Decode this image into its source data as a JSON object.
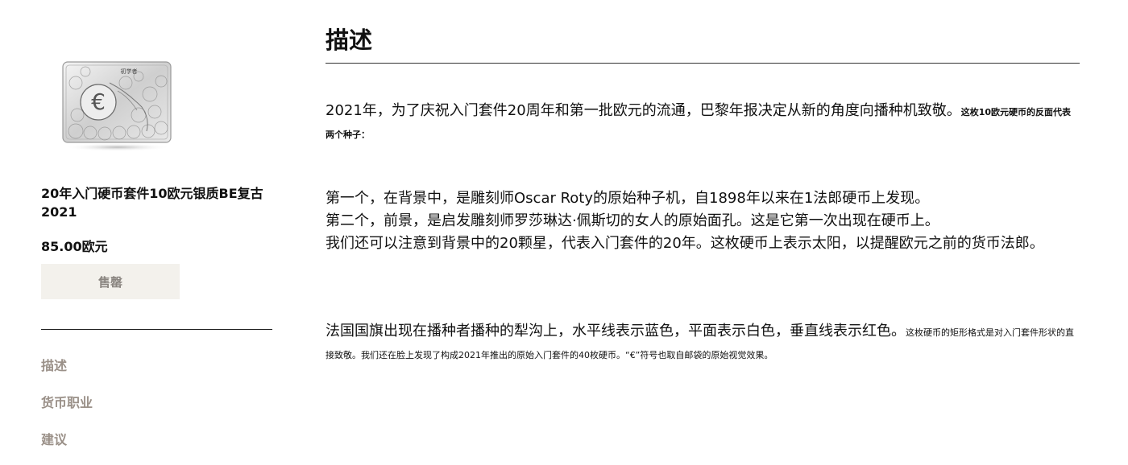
{
  "product": {
    "image_alt": "20年入门硬币套件10欧元银质BE复古2021",
    "coin_label": "初学者",
    "title": "20年入门硬币套件10欧元银质BE复古2021",
    "price": "85.00欧元",
    "button_label": "售罄"
  },
  "sidebar": {
    "nav": [
      {
        "label": "描述"
      },
      {
        "label": "货币职业"
      },
      {
        "label": "建议"
      }
    ]
  },
  "main": {
    "title": "描述",
    "p1": {
      "large": "2021年，为了庆祝入门套件20周年和第一批欧元的流通，巴黎年报决定从新的角度向播种机致敬。",
      "small": "这枚10欧元硬币的反面代表两个种子："
    },
    "p2": {
      "line1": "第一个，在背景中，是雕刻师Oscar Roty的原始种子机，自1898年以来在1法郎硬币上发现。",
      "line2": "第二个，前景，是启发雕刻师罗莎琳达·佩斯切的女人的原始面孔。这是它第一次出现在硬币上。",
      "line3": "我们还可以注意到背景中的20颗星，代表入门套件的20年。这枚硬币上表示太阳，以提醒欧元之前的货币法郎。"
    },
    "p3": {
      "large": "法国国旗出现在播种者播种的犁沟上，水平线表示蓝色，平面表示白色，垂直线表示红色。",
      "small": "这枚硬币的矩形格式是对入门套件形状的直接致敬。我们还在脸上发现了构成2021年推出的原始入门套件的40枚硬币。“€”符号也取自邮袋的原始视觉效果。"
    }
  },
  "colors": {
    "nav_text": "#9a9088",
    "button_bg": "#f3f1ec",
    "button_text": "#8a8580"
  }
}
